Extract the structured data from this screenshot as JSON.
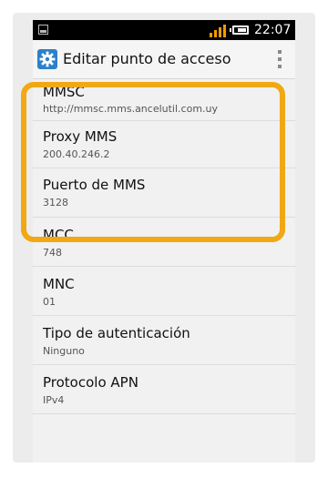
{
  "status_bar": {
    "time": "22:07",
    "signal_icon": "signal-icon",
    "battery_icon": "battery-icon",
    "signal_color": "#f29a00"
  },
  "action_bar": {
    "title": "Editar punto de acceso",
    "icon": "gear-icon",
    "icon_color": "#2c80c9"
  },
  "highlight_color": "#f0a814",
  "settings": [
    {
      "title": "MMSC",
      "value": "http://mmsc.mms.ancelutil.com.uy"
    },
    {
      "title": "Proxy MMS",
      "value": "200.40.246.2"
    },
    {
      "title": "Puerto de MMS",
      "value": "3128"
    },
    {
      "title": "MCC",
      "value": "748"
    },
    {
      "title": "MNC",
      "value": "01"
    },
    {
      "title": "Tipo de autenticación",
      "value": "Ninguno"
    },
    {
      "title": "Protocolo APN",
      "value": "IPv4"
    }
  ]
}
